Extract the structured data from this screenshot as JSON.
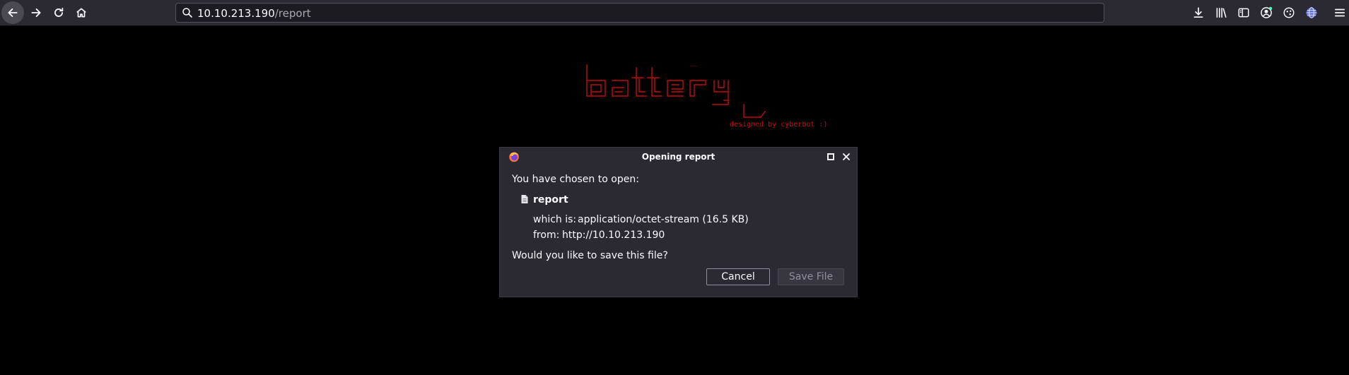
{
  "browser": {
    "url_host": "10.10.213.190",
    "url_path": "/report",
    "icons": {
      "back": "back-arrow-icon",
      "forward": "forward-arrow-icon",
      "reload": "reload-icon",
      "home": "home-icon",
      "search": "search-icon",
      "downloads": "download-icon",
      "library": "library-icon",
      "sidebar": "sidebar-icon",
      "account": "account-icon",
      "extensions": "extensions-icon",
      "vpn": "globe-icon",
      "menu": "hamburger-menu-icon"
    }
  },
  "page": {
    "logo_text": "battery",
    "tagline": "designed by cyberbot :)",
    "accent_color": "#d10d0d",
    "background_color": "#000000"
  },
  "dialog": {
    "title": "Opening report",
    "intro": "You have chosen to open:",
    "filename": "report",
    "which_is_label": "which is:",
    "which_is_value": "application/octet-stream (16.5 KB)",
    "from_label": "from:",
    "from_value": "http://10.10.213.190",
    "question": "Would you like to save this file?",
    "cancel_label": "Cancel",
    "save_label": "Save File"
  }
}
